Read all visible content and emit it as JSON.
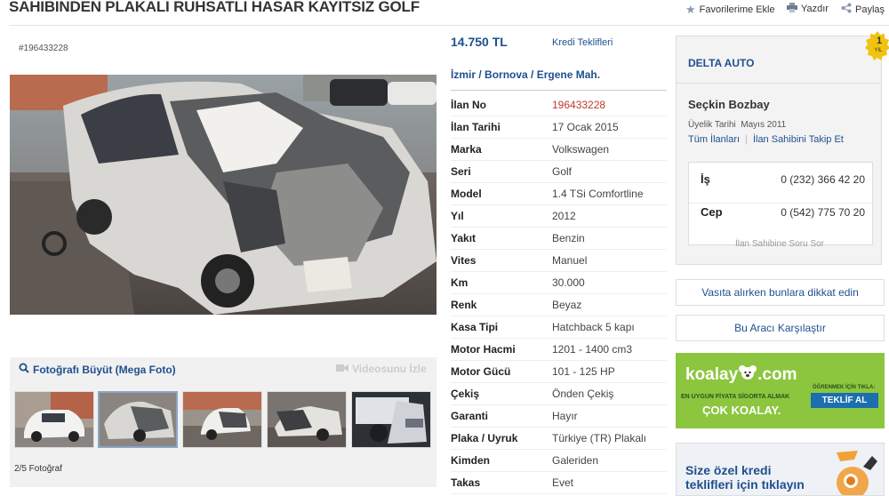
{
  "title": "SAHIBINDEN PLAKALI RUHSATLI HASAR KAYITSIZ GOLF",
  "header_links": {
    "favorite": "Favorilerime Ekle",
    "print": "Yazdır",
    "share": "Paylaş"
  },
  "listing": {
    "ad_number": "#196433228",
    "price": "14.750 TL",
    "credit_link": "Kredi Teklifleri",
    "location": {
      "city": "İzmir",
      "district": "Bornova",
      "neighborhood": "Ergene Mah.",
      "separator": " / "
    }
  },
  "details": [
    {
      "key": "İlan No",
      "value": "196433228"
    },
    {
      "key": "İlan Tarihi",
      "value": "17 Ocak 2015"
    },
    {
      "key": "Marka",
      "value": "Volkswagen"
    },
    {
      "key": "Seri",
      "value": "Golf"
    },
    {
      "key": "Model",
      "value": "1.4 TSi Comfortline"
    },
    {
      "key": "Yıl",
      "value": "2012"
    },
    {
      "key": "Yakıt",
      "value": "Benzin"
    },
    {
      "key": "Vites",
      "value": "Manuel"
    },
    {
      "key": "Km",
      "value": "30.000"
    },
    {
      "key": "Renk",
      "value": "Beyaz"
    },
    {
      "key": "Kasa Tipi",
      "value": "Hatchback 5 kapı"
    },
    {
      "key": "Motor Hacmi",
      "value": "1201 - 1400 cm3"
    },
    {
      "key": "Motor Gücü",
      "value": "101 - 125 HP"
    },
    {
      "key": "Çekiş",
      "value": "Önden Çekiş"
    },
    {
      "key": "Garanti",
      "value": "Hayır"
    },
    {
      "key": "Plaka / Uyruk",
      "value": "Türkiye (TR) Plakalı"
    },
    {
      "key": "Kimden",
      "value": "Galeriden"
    },
    {
      "key": "Takas",
      "value": "Evet"
    }
  ],
  "gallery": {
    "enlarge": "Fotoğrafı Büyüt (Mega Foto)",
    "video": "Videosunu İzle",
    "counter": "2/5 Fotoğraf"
  },
  "seller": {
    "store": "DELTA AUTO",
    "badge_number": "1",
    "badge_text": "YIL",
    "name": "Seçkin Bozbay",
    "member_since": "Üyelik Tarihi  Mayıs 2011",
    "all_ads": "Tüm İlanları",
    "follow": "İlan Sahibini Takip Et",
    "phones": [
      {
        "label": "İş",
        "number": "0 (232) 366 42 20"
      },
      {
        "label": "Cep",
        "number": "0 (542) 775 70 20"
      }
    ],
    "ask": "İlan Sahibine Soru Sor"
  },
  "sidebar": {
    "tips": "Vasıta alırken bunlara dikkat edin",
    "compare": "Bu Aracı Karşılaştır"
  },
  "koalay_ad": {
    "brand": "koalay",
    "brand_suffix": ".com",
    "tagline": "EN UYGUN FİYATA SİGORTA ALMAK",
    "slogan": "ÇOK KOALAY.",
    "learn": "ÖĞRENMEK İÇİN TIKLA:",
    "cta": "TEKLİF AL"
  },
  "credit_ad": {
    "line1": "Size özel kredi",
    "line2": "teklifleri için tıklayın"
  },
  "colors": {
    "link": "#1f4f8f",
    "red": "#c0392b",
    "koalay_green": "#8cc63f",
    "koalay_blue": "#1b6fae"
  }
}
